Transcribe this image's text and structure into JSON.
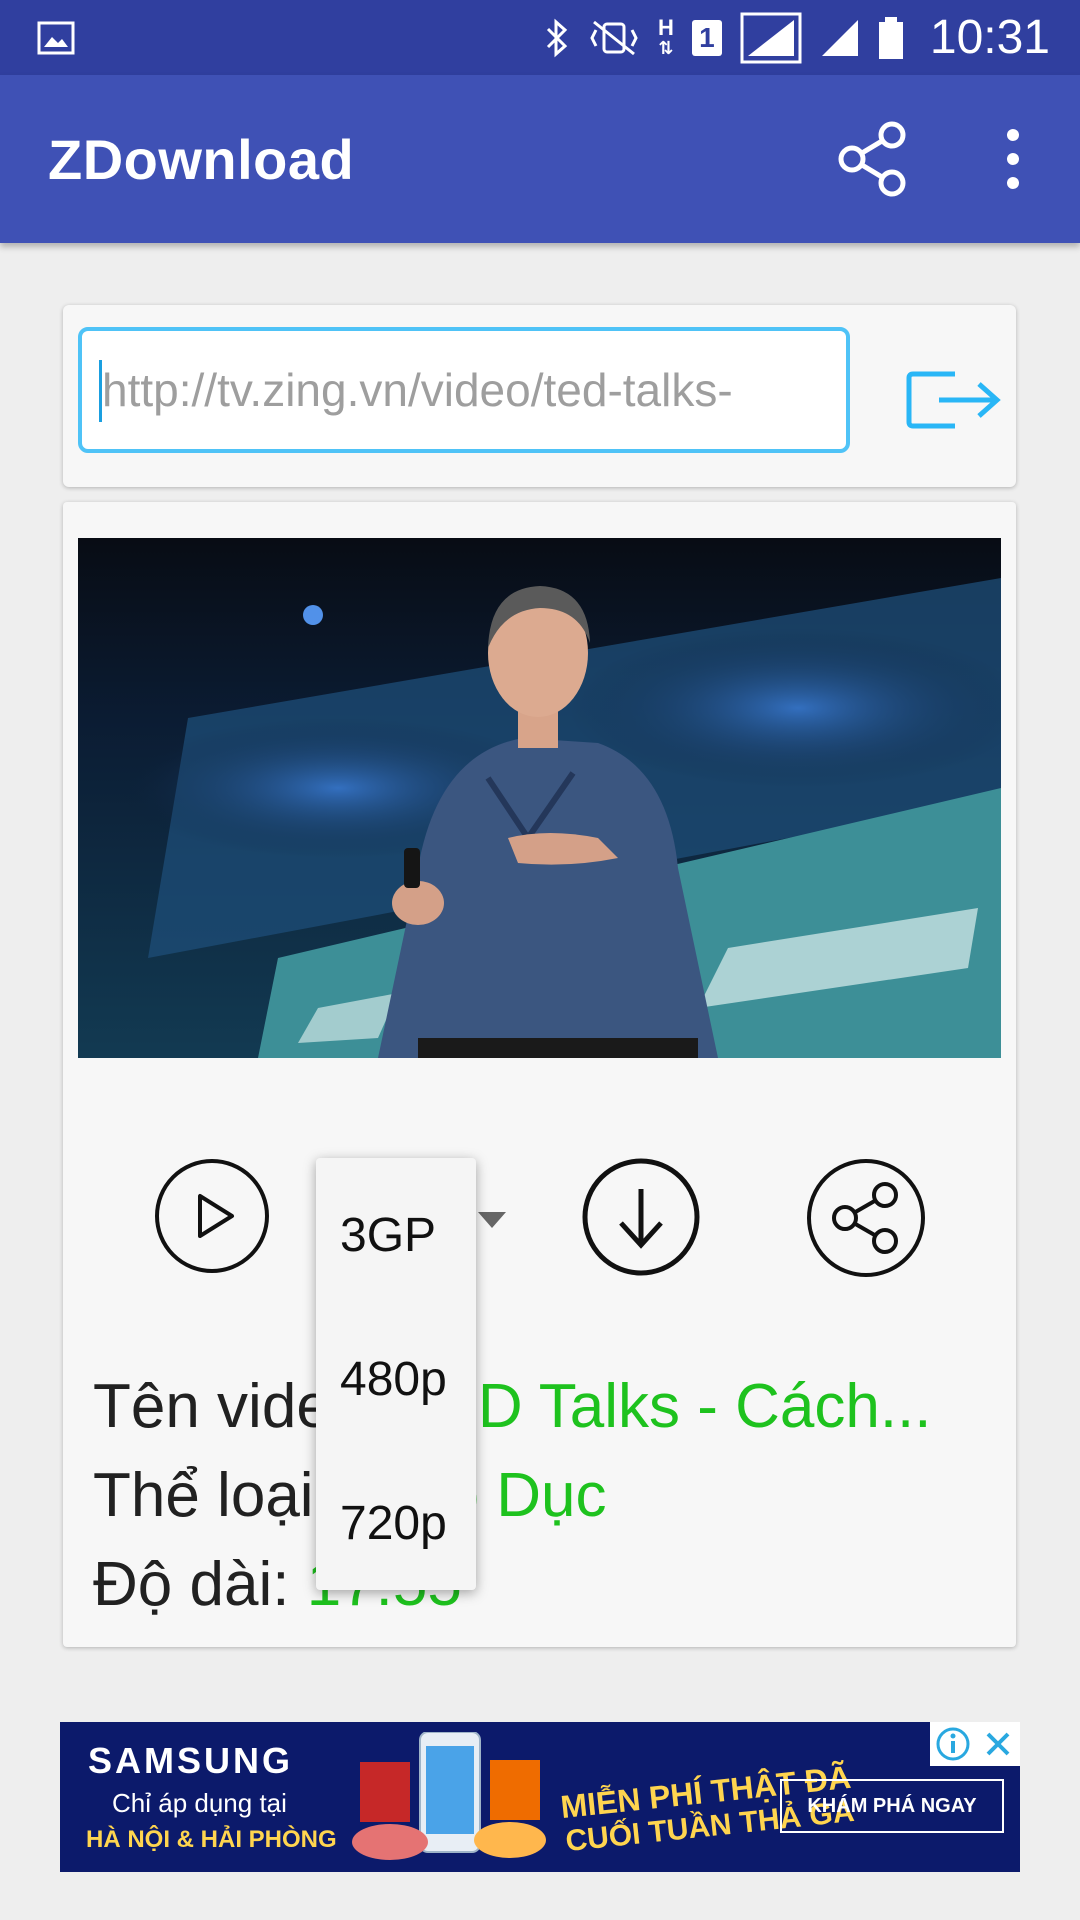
{
  "status_bar": {
    "time": "10:31",
    "network_letter": "H",
    "sim_label": "1"
  },
  "app_bar": {
    "title": "ZDownload"
  },
  "url_bar": {
    "value": "http://tv.zing.vn/video/ted-talks-"
  },
  "video": {
    "info": [
      {
        "label": "Tên video:",
        "value": "TED Talks - Cách..."
      },
      {
        "label": "Thể loại:",
        "value": "Giáo Dục"
      },
      {
        "label": "Độ dài:",
        "value": "17:55"
      }
    ]
  },
  "format_dropdown": {
    "options": [
      "3GP",
      "480p",
      "720p"
    ]
  },
  "ad": {
    "brand": "SAMSUNG",
    "line1": "Chỉ áp dụng tại",
    "line2": "HÀ NỘI & HẢI PHÒNG",
    "promo_line1": "MIỄN PHÍ THẬT ĐÃ",
    "promo_line2": "CUỐI TUẦN THẢ GA",
    "cta": "KHÁM PHÁ NGAY"
  },
  "colors": {
    "status_bar": "#303f9f",
    "app_bar": "#3f51b5",
    "accent_input_border": "#4fc3f7",
    "info_value": "#1ec21e",
    "background": "#eeeeee"
  }
}
